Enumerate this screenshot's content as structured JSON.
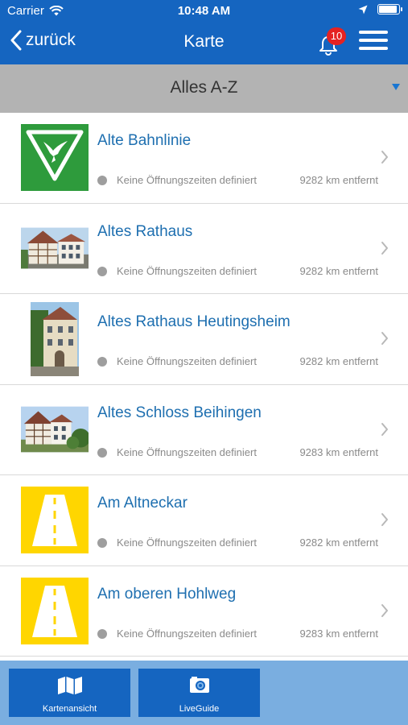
{
  "status_bar": {
    "carrier": "Carrier",
    "time": "10:48 AM"
  },
  "nav": {
    "back_label": "zurück",
    "title": "Karte",
    "notification_count": "10"
  },
  "filter": {
    "label": "Alles A-Z"
  },
  "list": {
    "items": [
      {
        "title": "Alte Bahnlinie",
        "hours": "Keine Öffnungszeiten definiert",
        "distance": "9282 km entfernt",
        "thumb": "nature-reserve-icon"
      },
      {
        "title": "Altes Rathaus",
        "hours": "Keine Öffnungszeiten definiert",
        "distance": "9282 km entfernt",
        "thumb": "town-hall-photo"
      },
      {
        "title": "Altes Rathaus Heutingsheim",
        "hours": "Keine Öffnungszeiten definiert",
        "distance": "9282 km entfernt",
        "thumb": "town-hall-heutingsheim-photo"
      },
      {
        "title": "Altes Schloss Beihingen",
        "hours": "Keine Öffnungszeiten definiert",
        "distance": "9283 km entfernt",
        "thumb": "castle-photo"
      },
      {
        "title": "Am Altneckar",
        "hours": "Keine Öffnungszeiten definiert",
        "distance": "9282 km entfernt",
        "thumb": "road-icon"
      },
      {
        "title": "Am oberen Hohlweg",
        "hours": "Keine Öffnungszeiten definiert",
        "distance": "9283 km entfernt",
        "thumb": "road-icon"
      }
    ]
  },
  "bottom": {
    "map_label": "Kartenansicht",
    "live_label": "LiveGuide"
  },
  "colors": {
    "header": "#1565c0",
    "filter_bar": "#b3b3b3",
    "title_text": "#1e6fb0",
    "bottom_bar": "#7aaee0",
    "badge": "#e52222",
    "nature_green": "#2e9b3c",
    "road_yellow": "#ffd600"
  }
}
